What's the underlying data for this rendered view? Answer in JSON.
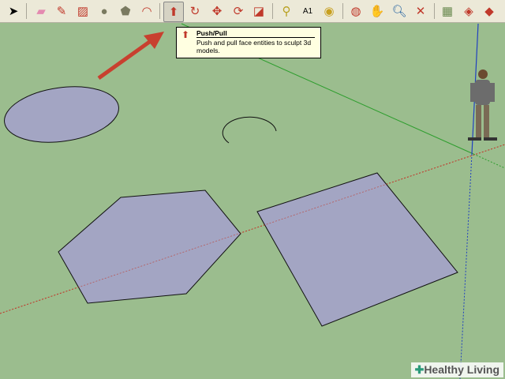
{
  "toolbar": {
    "tools": [
      "select",
      "eraser",
      "pencil",
      "rectangle",
      "circle",
      "polygon",
      "arc",
      "push-pull",
      "offset",
      "move",
      "rotate",
      "scale",
      "tape-measure",
      "text",
      "paint-bucket",
      "orbit",
      "pan",
      "zoom",
      "zoom-extents",
      "map",
      "warehouse",
      "component"
    ],
    "active": "push-pull"
  },
  "tooltip": {
    "title": "Push/Pull",
    "description": "Push and pull face entities to sculpt 3d models."
  },
  "watermark": {
    "brand": "Healthy Living"
  },
  "colors": {
    "ground": "#9bbd8e",
    "face": "#a3a5c3",
    "axis_red": "#c0392b",
    "axis_green": "#2e9e2e",
    "axis_blue": "#2040c0",
    "arrow": "#c8402f"
  }
}
